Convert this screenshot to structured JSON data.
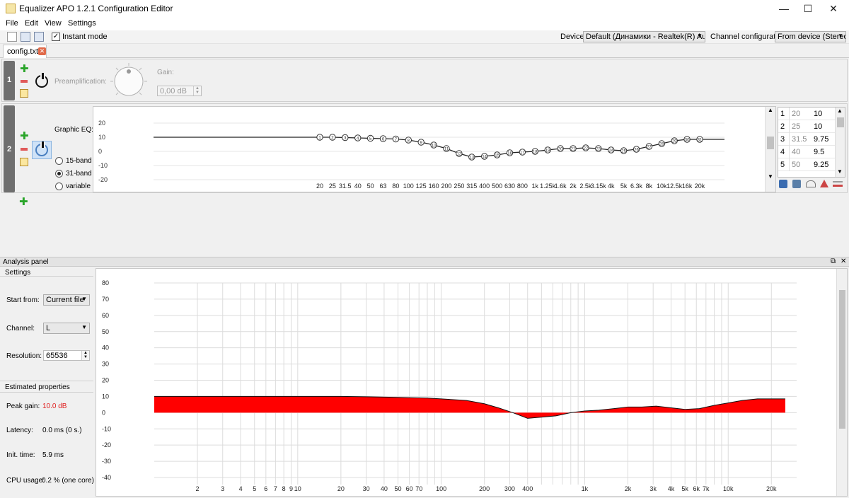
{
  "window": {
    "title": "Equalizer APO 1.2.1 Configuration Editor",
    "controls": {
      "minimize": "—",
      "maximize": "☐",
      "close": "✕"
    }
  },
  "menu": [
    "File",
    "Edit",
    "View",
    "Settings"
  ],
  "toolbar": {
    "instant_mode_label": "Instant mode",
    "instant_mode_checked": true,
    "device_label": "Device:",
    "device_value": "Default (Динамики - Realtek(R) Audio)",
    "channel_config_label": "Channel configuration:",
    "channel_config_value": "From device (Stereo)"
  },
  "tabs": [
    {
      "label": "config.txt",
      "close_icon": "close-icon"
    }
  ],
  "filter1": {
    "index": "1",
    "preamp_label": "Preamplification:",
    "gain_label": "Gain:",
    "gain_value": "0,00 dB"
  },
  "filter2": {
    "index": "2",
    "title": "Graphic EQ:",
    "band_options": [
      "15-band",
      "31-band",
      "variable"
    ],
    "selected_band_option": "31-band",
    "graph": {
      "y_ticks": [
        "20",
        "10",
        "0",
        "-10",
        "-20"
      ],
      "x_ticks": [
        "20",
        "25",
        "31.5",
        "40",
        "50",
        "63",
        "80",
        "100",
        "125",
        "160",
        "200",
        "250",
        "315",
        "400",
        "500",
        "630",
        "800",
        "1k",
        "1.25k",
        "1.6k",
        "2k",
        "2.5k",
        "3.15k",
        "4k",
        "5k",
        "6.3k",
        "8k",
        "10k",
        "12.5k",
        "16k",
        "20k"
      ],
      "gains": [
        10,
        10,
        9.75,
        9.5,
        9.25,
        9,
        8.75,
        8,
        6.5,
        4.5,
        2,
        -1.5,
        -4,
        -3.5,
        -2.5,
        -1,
        -0.5,
        0,
        1,
        2,
        2,
        2.5,
        2,
        1,
        0.5,
        1.5,
        3.5,
        5.5,
        7.5,
        8.5,
        8.5
      ]
    },
    "table": [
      {
        "n": "1",
        "freq": "20",
        "gain": "10"
      },
      {
        "n": "2",
        "freq": "25",
        "gain": "10"
      },
      {
        "n": "3",
        "freq": "31.5",
        "gain": "9.75"
      },
      {
        "n": "4",
        "freq": "40",
        "gain": "9.5"
      },
      {
        "n": "5",
        "freq": "50",
        "gain": "9.25"
      }
    ]
  },
  "analysis": {
    "title": "Analysis panel",
    "settings_label": "Settings",
    "start_from_label": "Start from:",
    "start_from_value": "Current file",
    "channel_label": "Channel:",
    "channel_value": "L",
    "resolution_label": "Resolution:",
    "resolution_value": "65536",
    "estimated_label": "Estimated properties",
    "peak_gain_label": "Peak gain:",
    "peak_gain_value": "10.0 dB",
    "peak_gain_color": "#e02020",
    "latency_label": "Latency:",
    "latency_value": "0.0 ms (0 s.)",
    "init_time_label": "Init. time:",
    "init_time_value": "5.9 ms",
    "cpu_usage_label": "CPU usage:",
    "cpu_usage_value": "0.2 % (one core)"
  },
  "chart_data": {
    "type": "area",
    "y_ticks": [
      "80",
      "70",
      "60",
      "50",
      "40",
      "30",
      "20",
      "10",
      "0",
      "-10",
      "-20",
      "-30",
      "-40"
    ],
    "ylim": [
      -40,
      80
    ],
    "x_scale": "log",
    "xlim": [
      1,
      30000
    ],
    "x_ticks": [
      "2",
      "3",
      "4",
      "5",
      "6",
      "7",
      "8",
      "9",
      "10",
      "20",
      "30",
      "40",
      "50",
      "60",
      "70",
      "100",
      "200",
      "300",
      "400",
      "1k",
      "2k",
      "3k",
      "4k",
      "5k",
      "6k",
      "7k",
      "10k",
      "20k"
    ],
    "x_tick_values": [
      2,
      3,
      4,
      5,
      6,
      7,
      8,
      9,
      10,
      20,
      30,
      40,
      50,
      60,
      70,
      100,
      200,
      300,
      400,
      1000,
      2000,
      3000,
      4000,
      5000,
      6000,
      7000,
      10000,
      20000
    ],
    "grid": true,
    "fill_color": "#ff0000",
    "series": [
      {
        "x": [
          1,
          10,
          20,
          30,
          50,
          80,
          100,
          150,
          200,
          250,
          315,
          400,
          630,
          800,
          1000,
          1250,
          1600,
          2000,
          2500,
          3150,
          4000,
          5000,
          6300,
          8000,
          10000,
          12500,
          16000,
          20000,
          25000
        ],
        "y": [
          10,
          10,
          10,
          9.8,
          9.4,
          9,
          8.5,
          7.5,
          5.5,
          3,
          0,
          -3.5,
          -2,
          0,
          1,
          1.5,
          2.5,
          3.5,
          3.5,
          4,
          3,
          2,
          2.5,
          4.5,
          6,
          7.5,
          8.5,
          8.5,
          8.5
        ]
      }
    ]
  }
}
